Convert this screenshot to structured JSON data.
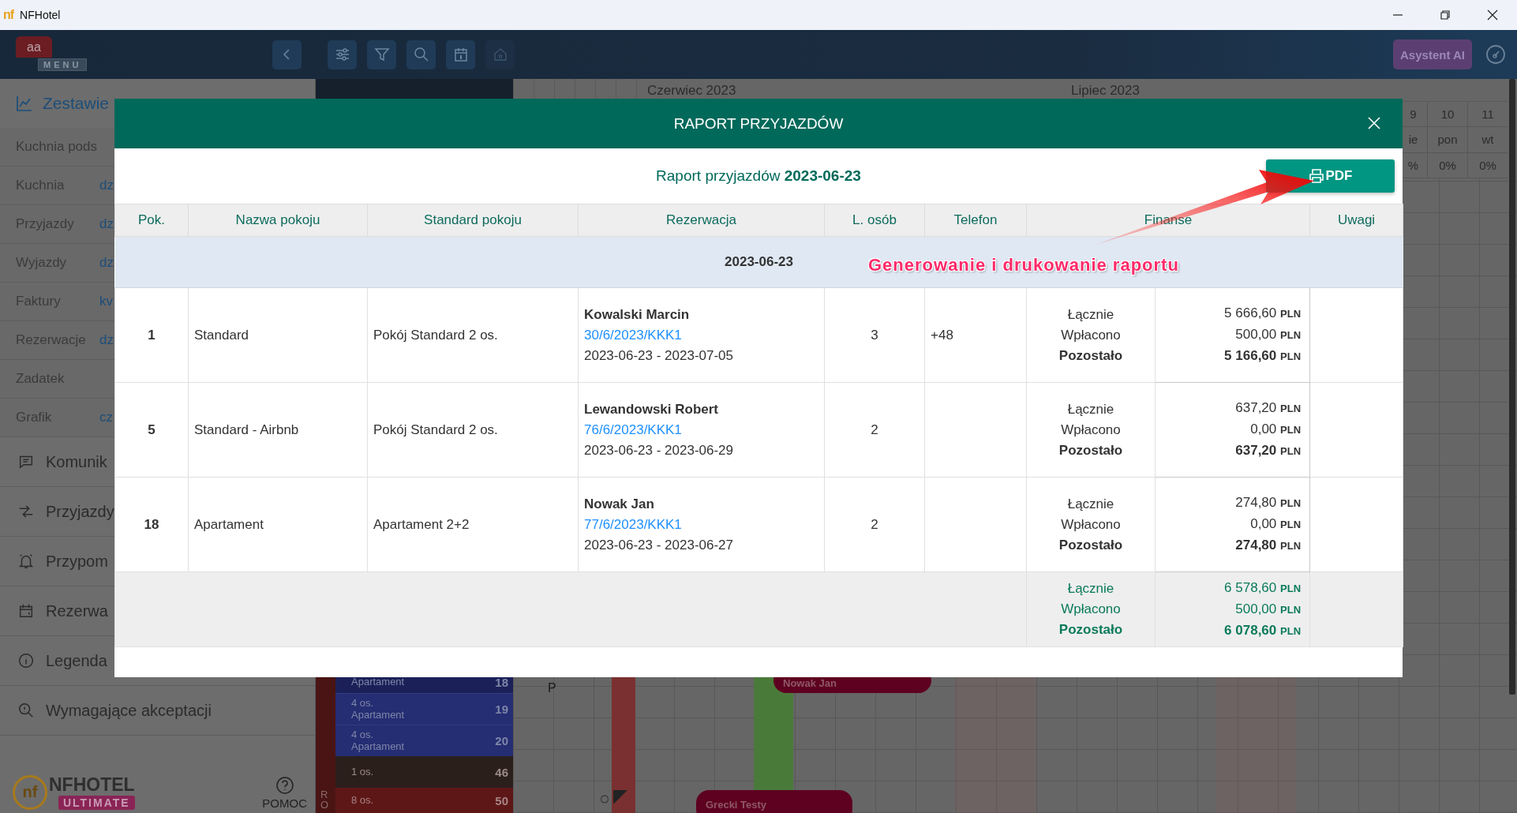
{
  "window": {
    "icon_text": "nf",
    "title": "NFHotel"
  },
  "header": {
    "avatar": "aa",
    "menu_label": "MENU",
    "assistant_button": "Asystent AI"
  },
  "sidebar": {
    "section": "Zestawie",
    "reports": [
      {
        "label": "Kuchnia pods"
      },
      {
        "label": "Kuchnia",
        "link": "dz"
      },
      {
        "label": "Przyjazdy",
        "link": "dz"
      },
      {
        "label": "Wyjazdy",
        "link": "dz"
      },
      {
        "label": "Faktury",
        "link": "kv"
      },
      {
        "label": "Rezerwacje",
        "link": "dz"
      },
      {
        "label": "Zadatek"
      },
      {
        "label": "Grafik",
        "link": "cz"
      }
    ],
    "menu": [
      "Komunik",
      "Przyjazdy",
      "Przypom",
      "Rezerwa",
      "Legenda",
      "Wymagające akceptacji"
    ],
    "logo": {
      "mark": "nf",
      "brand": "NFHOTEL",
      "edition": "ULTIMATE"
    },
    "help": "POMOC"
  },
  "calendar": {
    "months": [
      "Czerwiec 2023",
      "Lipiec 2023"
    ],
    "days": [
      {
        "day": "9",
        "weekday": "ie",
        "occupancy": "%"
      },
      {
        "day": "10",
        "weekday": "pon",
        "occupancy": "0%"
      },
      {
        "day": "11",
        "weekday": "wt",
        "occupancy": "0%"
      }
    ],
    "floor_label": "RO",
    "rooms": [
      {
        "type": "Apartament",
        "number": "18"
      },
      {
        "capacity": "4 os.",
        "type": "Apartament",
        "number": "19"
      },
      {
        "capacity": "4 os.",
        "type": "Apartament",
        "number": "20"
      },
      {
        "capacity": "1 os.",
        "number": "46"
      },
      {
        "capacity": "8 os.",
        "number": "50"
      }
    ],
    "cell_marks": [
      "P",
      "O"
    ],
    "bookings": [
      {
        "guest": "Nowak Jan"
      },
      {
        "guest": "Grecki Testy"
      }
    ]
  },
  "report": {
    "title": "RAPORT PRZYJAZDÓW",
    "heading": "Raport przyjazdów **2023-06-23**",
    "pdf_button": "PDF",
    "columns": [
      "Pok.",
      "Nazwa pokoju",
      "Standard pokoju",
      "Rezerwacja",
      "L. osób",
      "Telefon",
      "Finanse",
      "Uwagi"
    ],
    "group": "2023-06-23",
    "rows": [
      {
        "room": "1",
        "name": "Standard",
        "standard": "Pokój Standard 2 os.",
        "guest": "Kowalski Marcin",
        "reservation": "30/6/2023/KKK1",
        "dates": "2023-06-23 - 2023-07-05",
        "persons": "3",
        "phone": "+48",
        "finance": [
          {
            "label": "Łącznie",
            "value": "5 666,60",
            "currency": "PLN"
          },
          {
            "label": "Wpłacono",
            "value": "500,00",
            "currency": "PLN"
          },
          {
            "label": "Pozostało",
            "value": "5 166,60",
            "currency": "PLN"
          }
        ]
      },
      {
        "room": "5",
        "name": "Standard - Airbnb",
        "standard": "Pokój Standard 2 os.",
        "guest": "Lewandowski Robert",
        "reservation": "76/6/2023/KKK1",
        "dates": "2023-06-23 - 2023-06-29",
        "persons": "2",
        "finance": [
          {
            "label": "Łącznie",
            "value": "637,20",
            "currency": "PLN"
          },
          {
            "label": "Wpłacono",
            "value": "0,00",
            "currency": "PLN"
          },
          {
            "label": "Pozostało",
            "value": "637,20",
            "currency": "PLN"
          }
        ]
      },
      {
        "room": "18",
        "name": "Apartament",
        "standard": "Apartament 2+2",
        "guest": "Nowak Jan",
        "reservation": "77/6/2023/KKK1",
        "dates": "2023-06-23 - 2023-06-27",
        "persons": "2",
        "finance": [
          {
            "label": "Łącznie",
            "value": "274,80",
            "currency": "PLN"
          },
          {
            "label": "Wpłacono",
            "value": "0,00",
            "currency": "PLN"
          },
          {
            "label": "Pozostało",
            "value": "274,80",
            "currency": "PLN"
          }
        ]
      }
    ],
    "totals": [
      {
        "label": "Łącznie",
        "value": "6 578,60",
        "currency": "PLN"
      },
      {
        "label": "Wpłacono",
        "value": "500,00",
        "currency": "PLN"
      },
      {
        "label": "Pozostało",
        "value": "6 078,60",
        "currency": "PLN"
      }
    ]
  },
  "annotation": {
    "text": "Generowanie i drukowanie raportu"
  }
}
